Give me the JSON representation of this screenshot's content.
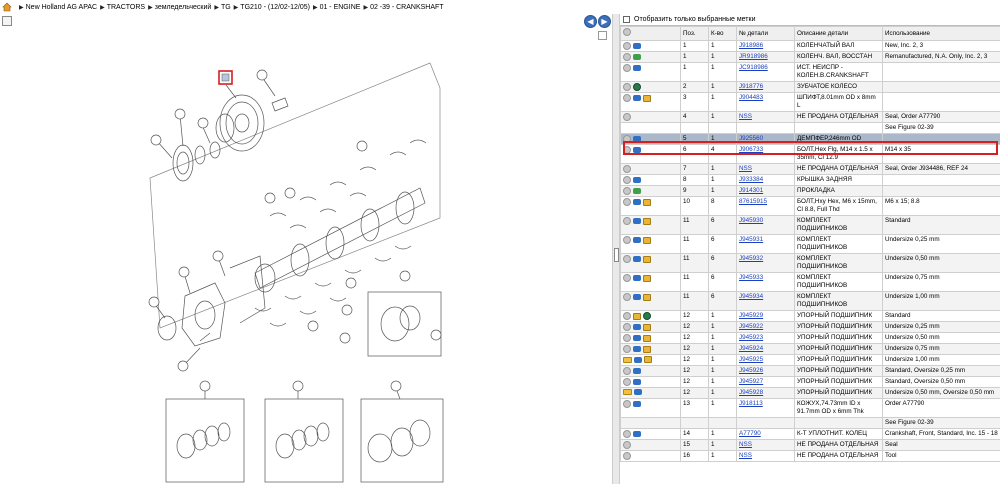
{
  "breadcrumb": [
    "New Holland AG APAC",
    "TRACTORS",
    "земледельческий",
    "TG",
    "TG210 - (12/02-12/05)",
    "01 - ENGINE",
    "02 -39 - CRANKSHAFT"
  ],
  "filter_label": "Отобразить только выбранные метки",
  "columns": [
    "Поз.",
    "К-во",
    "№ детали",
    "Описание детали",
    "Использование"
  ],
  "rows": [
    {
      "icons": [
        "grey",
        "blue"
      ],
      "pos": "1",
      "qty": "1",
      "part": "J918986",
      "desc": "КОЛЕНЧАТЫЙ ВАЛ",
      "usage": "New, Inc. 2, 3"
    },
    {
      "icons": [
        "grey",
        "green"
      ],
      "pos": "1",
      "qty": "1",
      "part": "JR918986",
      "desc": "КОЛЕНЧ. ВАЛ, ВОССТАН",
      "usage": "Remanufactured, N.A. Only, Inc. 2, 3"
    },
    {
      "icons": [
        "grey",
        "blue"
      ],
      "pos": "1",
      "qty": "1",
      "part": "JC918986",
      "desc": "ИСТ. НЕИСПР - КОЛЕН.В.CRANKSHAFT",
      "usage": ""
    },
    {
      "icons": [
        "grey",
        "gear"
      ],
      "pos": "2",
      "qty": "1",
      "part": "J918776",
      "desc": "ЗУБЧАТОЕ КОЛЕСО",
      "usage": ""
    },
    {
      "icons": [
        "grey",
        "blue",
        "box"
      ],
      "pos": "3",
      "qty": "1",
      "part": "J904483",
      "desc": "ШПИФТ,8.01mm OD x 8mm L",
      "usage": ""
    },
    {
      "icons": [
        "grey"
      ],
      "pos": "4",
      "qty": "1",
      "part": "NSS",
      "desc": "НЕ ПРОДАНА ОТДЕЛЬНАЯ",
      "usage": "Seal, Order A77790"
    },
    {
      "icons": [],
      "pos": "",
      "qty": "",
      "part": "",
      "desc": "",
      "usage": "See Figure 02-39"
    },
    {
      "icons": [
        "grey",
        "blue"
      ],
      "pos": "5",
      "qty": "1",
      "part": "J925560",
      "desc": "ДЕМПФЕР,246mm OD",
      "usage": "",
      "selected": true
    },
    {
      "icons": [
        "grey",
        "blue"
      ],
      "pos": "6",
      "qty": "4",
      "part": "J906733",
      "desc": "БОЛТ,Hex Flg, M14 x 1.5 x 35mm, Cl 12.9",
      "usage": "M14 x 35"
    },
    {
      "icons": [
        "grey"
      ],
      "pos": "7",
      "qty": "1",
      "part": "NSS",
      "desc": "НЕ ПРОДАНА ОТДЕЛЬНАЯ",
      "usage": "Seal, Order J934486, REF 24"
    },
    {
      "icons": [
        "grey",
        "blue"
      ],
      "pos": "8",
      "qty": "1",
      "part": "J933384",
      "desc": "КРЫШКА ЗАДНЯЯ",
      "usage": ""
    },
    {
      "icons": [
        "grey",
        "green"
      ],
      "pos": "9",
      "qty": "1",
      "part": "J914301",
      "desc": "ПРОКЛАДКА",
      "usage": ""
    },
    {
      "icons": [
        "grey",
        "blue",
        "box"
      ],
      "pos": "10",
      "qty": "8",
      "part": "87615915",
      "desc": "БОЛТ,Hxy Hex, M6 x 15mm, Cl 8.8, Full Thd",
      "usage": "M6 x 15; 8.8"
    },
    {
      "icons": [
        "grey",
        "blue",
        "box"
      ],
      "pos": "11",
      "qty": "6",
      "part": "J945930",
      "desc": "КОМПЛЕКТ ПОДШИПНИКОВ",
      "usage": "Standard"
    },
    {
      "icons": [
        "grey",
        "blue",
        "box"
      ],
      "pos": "11",
      "qty": "6",
      "part": "J945931",
      "desc": "КОМПЛЕКТ ПОДШИПНИКОВ",
      "usage": "Undersize 0,25 mm"
    },
    {
      "icons": [
        "grey",
        "blue",
        "box"
      ],
      "pos": "11",
      "qty": "6",
      "part": "J945932",
      "desc": "КОМПЛЕКТ ПОДШИПНИКОВ",
      "usage": "Undersize 0,50 mm"
    },
    {
      "icons": [
        "grey",
        "blue",
        "box"
      ],
      "pos": "11",
      "qty": "6",
      "part": "J945933",
      "desc": "КОМПЛЕКТ ПОДШИПНИКОВ",
      "usage": "Undersize 0,75 mm"
    },
    {
      "icons": [
        "grey",
        "blue",
        "box"
      ],
      "pos": "11",
      "qty": "6",
      "part": "J945934",
      "desc": "КОМПЛЕКТ ПОДШИПНИКОВ",
      "usage": "Undersize 1,00 mm"
    },
    {
      "icons": [
        "grey",
        "box",
        "gear"
      ],
      "pos": "12",
      "qty": "1",
      "part": "J945929",
      "desc": "УПОРНЫЙ ПОДШИПНИК",
      "usage": "Standard"
    },
    {
      "icons": [
        "grey",
        "blue",
        "box"
      ],
      "pos": "12",
      "qty": "1",
      "part": "J945922",
      "desc": "УПОРНЫЙ ПОДШИПНИК",
      "usage": "Undersize 0,25 mm"
    },
    {
      "icons": [
        "grey",
        "blue",
        "box"
      ],
      "pos": "12",
      "qty": "1",
      "part": "J945923",
      "desc": "УПОРНЫЙ ПОДШИПНИК",
      "usage": "Undersize 0,50 mm"
    },
    {
      "icons": [
        "grey",
        "blue",
        "box"
      ],
      "pos": "12",
      "qty": "1",
      "part": "J945924",
      "desc": "УПОРНЫЙ ПОДШИПНИК",
      "usage": "Undersize 0,75 mm"
    },
    {
      "icons": [
        "folder",
        "blue",
        "box"
      ],
      "pos": "12",
      "qty": "1",
      "part": "J945925",
      "desc": "УПОРНЫЙ ПОДШИПНИК",
      "usage": "Undersize 1,00 mm"
    },
    {
      "icons": [
        "grey",
        "blue"
      ],
      "pos": "12",
      "qty": "1",
      "part": "J945926",
      "desc": "УПОРНЫЙ ПОДШИПНИК",
      "usage": "Standard, Oversize 0,25 mm"
    },
    {
      "icons": [
        "grey",
        "blue"
      ],
      "pos": "12",
      "qty": "1",
      "part": "J945927",
      "desc": "УПОРНЫЙ ПОДШИПНИК",
      "usage": "Standard, Oversize 0,50 mm"
    },
    {
      "icons": [
        "folder",
        "blue"
      ],
      "pos": "12",
      "qty": "1",
      "part": "J945928",
      "desc": "УПОРНЫЙ ПОДШИПНИК",
      "usage": "Undersize 0,50 mm, Oversize 0,50 mm"
    },
    {
      "icons": [
        "grey",
        "blue"
      ],
      "pos": "13",
      "qty": "1",
      "part": "J918113",
      "desc": "КОЖУХ,74.73mm ID x 91.7mm OD x 6mm Thk",
      "usage": "Order A77790"
    },
    {
      "icons": [],
      "pos": "",
      "qty": "",
      "part": "",
      "desc": "",
      "usage": "See Figure 02-39"
    },
    {
      "icons": [
        "grey",
        "blue"
      ],
      "pos": "14",
      "qty": "1",
      "part": "A77790",
      "desc": "К-Т УПЛОТНИТ. КОЛЕЦ",
      "usage": "Crankshaft, Front, Standard, Inc. 15 - 18"
    },
    {
      "icons": [
        "grey"
      ],
      "pos": "15",
      "qty": "1",
      "part": "NSS",
      "desc": "НЕ ПРОДАНА ОТДЕЛЬНАЯ",
      "usage": "Seal"
    },
    {
      "icons": [
        "grey"
      ],
      "pos": "16",
      "qty": "1",
      "part": "NSS",
      "desc": "НЕ ПРОДАНА ОТДЕЛЬНАЯ",
      "usage": "Tool"
    }
  ]
}
